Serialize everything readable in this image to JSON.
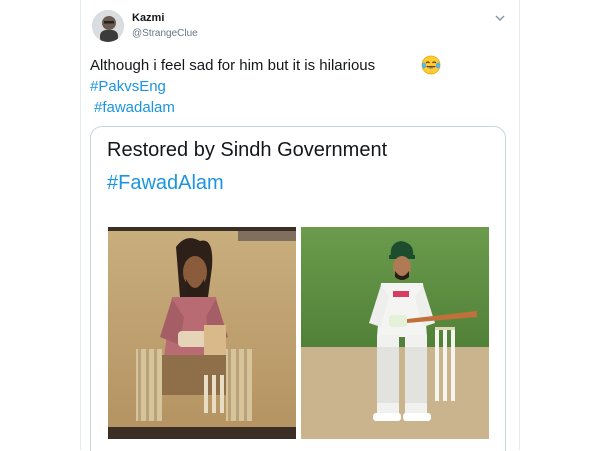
{
  "tweet": {
    "author_name": "Kazmi",
    "author_handle": "@StrangeClue",
    "text": "Although i feel sad for him but it is hilarious",
    "emoji": "face-with-tears-of-joy-emoji",
    "hashtags": [
      "#PakvsEng",
      "#fawadalam"
    ]
  },
  "card": {
    "title": "Restored by Sindh Government",
    "hashtag": "#FawadAlam"
  },
  "icons": {
    "menu": "chevron-down-icon",
    "avatar": "avatar"
  },
  "colors": {
    "link": "#1b95e0",
    "text": "#14171a",
    "muted": "#657786",
    "border": "#ccd6dd"
  }
}
